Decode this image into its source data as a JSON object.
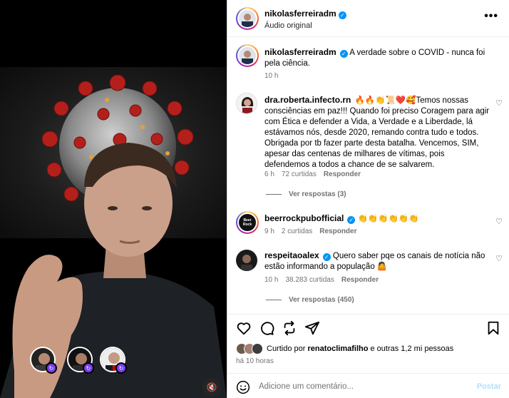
{
  "header": {
    "username": "nikolasferreiradm",
    "audio": "Áudio original",
    "more_icon": "•••"
  },
  "caption": {
    "username": "nikolasferreiradm",
    "text": "A verdade sobre o COVID - nunca foi pela ciência.",
    "time": "10 h"
  },
  "comments": [
    {
      "username": "dra.roberta.infecto.rn",
      "text": "🔥🔥👏📜❤️🥰Temos nossas consciências em paz!!! Quando foi preciso Coragem para agir com Ética e defender a Vida, a Verdade e a Liberdade, lá estávamos nós, desde 2020, remando contra tudo e todos. Obrigada por tb fazer parte desta batalha. Vencemos, SIM, apesar das centenas de milhares de vítimas, pois defendemos a todos a chance de se salvarem.",
      "time": "6 h",
      "likes": "72 curtidas",
      "reply": "Responder",
      "replies": "Ver respostas (3)"
    },
    {
      "username": "beerrockpubofficial",
      "text": "👏👏👏👏👏👏",
      "time": "9 h",
      "likes": "2 curtidas",
      "reply": "Responder",
      "logo_text": "Beer Rock"
    },
    {
      "username": "respeitaoalex",
      "text": "Quero saber pqe os canais de notícia não estão informando a população 🤷",
      "time": "10 h",
      "likes": "38.283 curtidas",
      "reply": "Responder",
      "replies": "Ver respostas (450)"
    }
  ],
  "likes": {
    "prefix": "Curtido por ",
    "user": "renatoclimafilho",
    "suffix": " e outras 1,2 mi pessoas"
  },
  "post_time": "há 10 horas",
  "add_comment": {
    "placeholder": "Adicione um comentário...",
    "post_label": "Postar"
  },
  "icons": {
    "mute": "🔇",
    "heart": "♡",
    "cohost_badge": "↻"
  },
  "colors": {
    "verified": "#0095f6",
    "post_disabled": "#b2dffc",
    "meta_gray": "#737373"
  }
}
